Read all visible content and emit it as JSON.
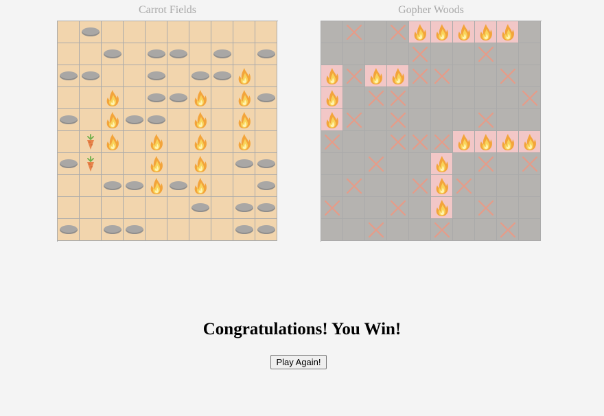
{
  "boards": [
    {
      "title": "Carrot Fields",
      "kind": "carrot",
      "grid": [
        "_H________",
        "__H_HH_H_H",
        "HH__H_HHF_",
        "__F_HHF_FH",
        "H_FHH_F_F_",
        "_CF_F_F_F_",
        "HC__F_F_HH",
        "__HHFHF__H",
        "______H_HH",
        "H_HH____HH"
      ]
    },
    {
      "title": "Gopher Woods",
      "kind": "gopher",
      "grid": [
        "_X_XFFFFF_",
        "____X__X__",
        "FXFFXX__X_",
        "F_XX_____X",
        "FX_X___X__",
        "X__XXXFFFF",
        "__X__F_X_X",
        "_X__XFX___",
        "X__X_F_X__",
        "__X__X__X_"
      ]
    }
  ],
  "legend": {
    "_": "empty",
    "H": "hole",
    "F": "fire-hit",
    "X": "miss-x",
    "C": "carrot"
  },
  "colors": {
    "carrot_cell": "#f2d5ad",
    "gopher_cell": "#b5b3b0",
    "hit_cell": "#f2c7c7",
    "miss_mark": "#e99a86"
  },
  "message": "Congratulations! You Win!",
  "play_again_label": "Play Again!"
}
